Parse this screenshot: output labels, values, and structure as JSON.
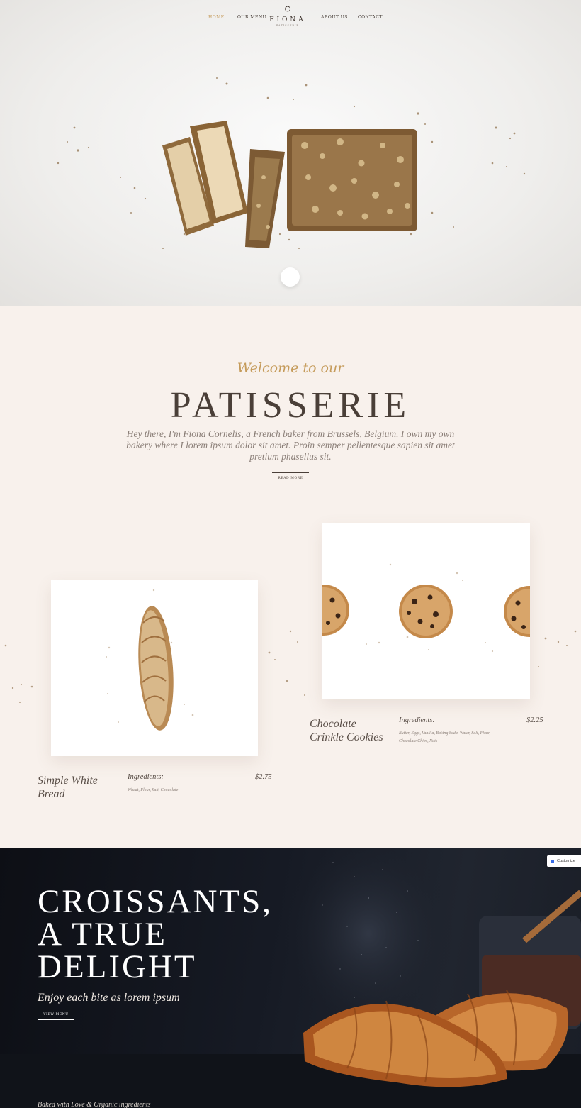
{
  "nav": {
    "items": [
      {
        "label": "HOME",
        "active": true
      },
      {
        "label": "OUR MENU",
        "active": false
      },
      {
        "label": "ABOUT US",
        "active": false
      },
      {
        "label": "CONTACT",
        "active": false
      }
    ],
    "logo_name": "FIONA",
    "logo_sub": "PATISSERIE",
    "accent_color": "#c59b5a"
  },
  "hero": {
    "scroll_icon": "plus-icon"
  },
  "welcome": {
    "script": "Welcome to our",
    "title": "PATISSERIE",
    "text": "Hey there, I'm Fiona Cornelis, a French baker from Brussels, Belgium. I own my own bakery where I lorem ipsum dolor sit amet. Proin semper pellentesque sapien sit amet pretium phasellus sit.",
    "button": "READ MORE"
  },
  "products": [
    {
      "name_line1": "Simple White",
      "name_line2": "Bread",
      "ingredients_label": "Ingredients:",
      "ingredients": "Wheat, Flour, Salt, Chocolate",
      "price": "$2.75"
    },
    {
      "name_line1": "Chocolate",
      "name_line2": "Crinkle Cookies",
      "ingredients_label": "Ingredients:",
      "ingredients": "Butter, Eggs, Vanilla, Baking Soda, Water, Salt, Flour, Chocolate Chips, Nuts",
      "price": "$2.25"
    }
  ],
  "croissant": {
    "title_line1": "CROISSANTS,",
    "title_line2": "A TRUE",
    "title_line3": "DELIGHT",
    "subtitle": "Enjoy each bite as lorem ipsum",
    "button": "VIEW MENU",
    "footer": "Baked with Love & Organic ingredients"
  },
  "customize": {
    "label": "Customize",
    "icon": "customize-icon"
  }
}
